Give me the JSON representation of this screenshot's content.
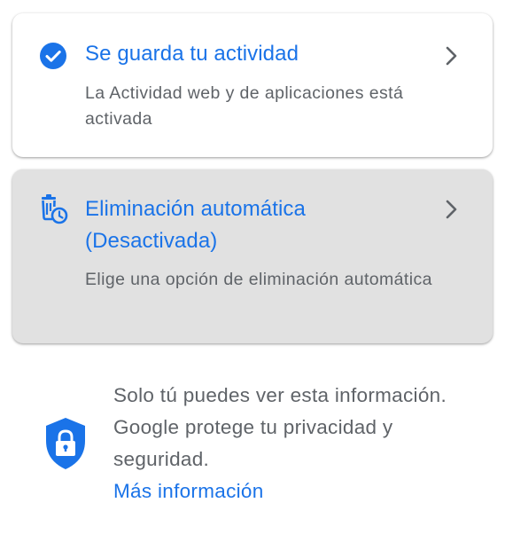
{
  "colors": {
    "accent": "#1a73e8",
    "secondary_text": "#5f6368",
    "disabled_card_bg": "#e1e1e1"
  },
  "activity_card": {
    "icon": "check-circle-icon",
    "title": "Se guarda tu actividad",
    "description": "La Actividad web y de aplicaciones está activada",
    "chevron_icon": "chevron-right-icon"
  },
  "auto_delete_card": {
    "icon": "auto-delete-icon",
    "title": "Eliminación automática (Desactivada)",
    "description": "Elige una opción de eliminación automática",
    "chevron_icon": "chevron-right-icon"
  },
  "privacy_notice": {
    "icon": "shield-lock-icon",
    "text": "Solo tú puedes ver esta información. Google protege tu privacidad y seguridad.",
    "link": "Más información"
  }
}
